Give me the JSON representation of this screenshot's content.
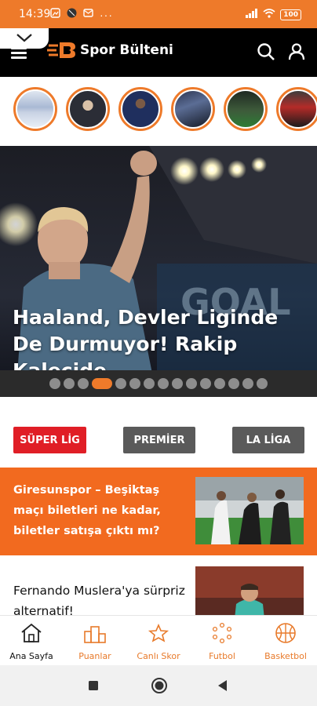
{
  "status_bar": {
    "time": "14:39",
    "battery": "100"
  },
  "app": {
    "logo_text": "Spor Bülteni"
  },
  "stories": [
    {
      "name": "story-1"
    },
    {
      "name": "story-2"
    },
    {
      "name": "story-3"
    },
    {
      "name": "story-4"
    },
    {
      "name": "story-5"
    },
    {
      "name": "story-6"
    }
  ],
  "hero": {
    "title": "Haaland, Devler Liginde De Durmuyor! Rakip Kalecide...",
    "slide_count": 15,
    "active_slide": 4
  },
  "tabs": [
    {
      "label": "SÜPER LİG",
      "color": "#e01e26"
    },
    {
      "label": "PREMİER",
      "color": "#5a5a5a"
    },
    {
      "label": "LA LİGA",
      "color": "#5a5a5a"
    }
  ],
  "news": [
    {
      "title": "Giresunspor – Beşiktaş maçı biletleri ne kadar, biletler satışa çıktı mı?"
    },
    {
      "title": "Fernando Muslera'ya sürpriz alternatif!"
    }
  ],
  "bottom_nav": [
    {
      "label": "Ana Sayfa",
      "icon": "home-icon",
      "active": true
    },
    {
      "label": "Puanlar",
      "icon": "podium-icon",
      "active": false
    },
    {
      "label": "Canlı Skor",
      "icon": "star-icon",
      "active": false
    },
    {
      "label": "Futbol",
      "icon": "dots-ring-icon",
      "active": false
    },
    {
      "label": "Basketbol",
      "icon": "basketball-icon",
      "active": false
    }
  ],
  "colors": {
    "accent": "#ee7a2a",
    "news_bg": "#f26a1f",
    "inactive_nav": "#e87a2a"
  }
}
